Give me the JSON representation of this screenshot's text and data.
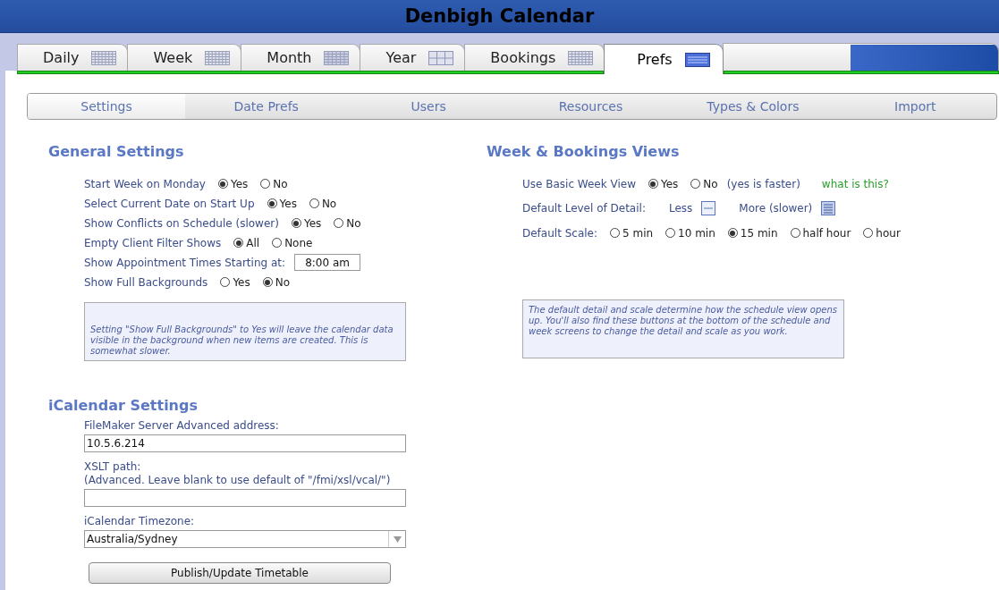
{
  "window": {
    "title": "Denbigh Calendar"
  },
  "tabs": [
    {
      "label": "Daily",
      "kind": "small-grid",
      "selected": false
    },
    {
      "label": "Week",
      "kind": "small-grid",
      "selected": false
    },
    {
      "label": "Month",
      "kind": "grid",
      "selected": false
    },
    {
      "label": "Year",
      "kind": "table",
      "selected": false
    },
    {
      "label": "Bookings",
      "kind": "small-grid",
      "selected": false
    },
    {
      "label": "Prefs",
      "kind": "lines",
      "selected": true
    }
  ],
  "subtabs": [
    {
      "label": "Settings",
      "selected": true
    },
    {
      "label": "Date Prefs",
      "selected": false
    },
    {
      "label": "Users",
      "selected": false
    },
    {
      "label": "Resources",
      "selected": false
    },
    {
      "label": "Types & Colors",
      "selected": false
    },
    {
      "label": "Import",
      "selected": false
    }
  ],
  "general": {
    "heading": "General Settings",
    "rows": [
      {
        "kind": "radio",
        "label": "Start Week on Monday",
        "options": [
          {
            "label": "Yes",
            "selected": true
          },
          {
            "label": "No",
            "selected": false
          }
        ]
      },
      {
        "kind": "radio",
        "label": "Select Current Date on Start Up",
        "options": [
          {
            "label": "Yes",
            "selected": true
          },
          {
            "label": "No",
            "selected": false
          }
        ]
      },
      {
        "kind": "radio",
        "label": "Show Conflicts on Schedule (slower)",
        "options": [
          {
            "label": "Yes",
            "selected": true
          },
          {
            "label": "No",
            "selected": false
          }
        ]
      },
      {
        "kind": "radio",
        "label": "Empty Client Filter Shows",
        "options": [
          {
            "label": "All",
            "selected": true
          },
          {
            "label": "None",
            "selected": false
          }
        ]
      },
      {
        "kind": "field",
        "label": "Show Appointment Times Starting at:",
        "value": "8:00 am"
      },
      {
        "kind": "radio",
        "label": "Show Full Backgrounds",
        "options": [
          {
            "label": "Yes",
            "selected": false
          },
          {
            "label": "No",
            "selected": true
          }
        ]
      }
    ],
    "note": "Setting \"Show Full Backgrounds\" to Yes will leave the calendar data visible in the background when new items are created. This is somewhat slower."
  },
  "week": {
    "heading": "Week & Bookings Views",
    "rows": [
      {
        "kind": "radio",
        "label": "Use Basic Week View",
        "options": [
          {
            "label": "Yes",
            "selected": true
          },
          {
            "label": "No",
            "selected": false
          }
        ],
        "hint": "(yes is faster)",
        "link": "what is this?"
      },
      {
        "kind": "detail",
        "label": "Default Level of Detail:",
        "options": [
          {
            "label": "Less",
            "kind": "less"
          },
          {
            "label": "More (slower)",
            "kind": "more"
          }
        ]
      },
      {
        "kind": "radio",
        "label": "Default Scale:",
        "options": [
          {
            "label": "5 min",
            "selected": false
          },
          {
            "label": "10 min",
            "selected": false
          },
          {
            "label": "15 min",
            "selected": true
          },
          {
            "label": "half hour",
            "selected": false
          },
          {
            "label": "hour",
            "selected": false
          }
        ]
      }
    ],
    "note": "The default detail and scale determine how the schedule view opens up. You'll also find these buttons at the bottom of the schedule and week screens to change the detail and scale as you work."
  },
  "icalendar": {
    "heading": "iCalendar Settings",
    "fields": [
      {
        "kind": "text",
        "label": "FileMaker Server Advanced address:",
        "value": "10.5.6.214"
      },
      {
        "kind": "text",
        "label": "XSLT path:",
        "sublabel": "(Advanced. Leave blank to use default of \"/fmi/xsl/vcal/\")"
      },
      {
        "kind": "select",
        "label": "iCalendar Timezone:",
        "value": "Australia/Sydney"
      }
    ],
    "button": "Publish/Update Timetable"
  }
}
